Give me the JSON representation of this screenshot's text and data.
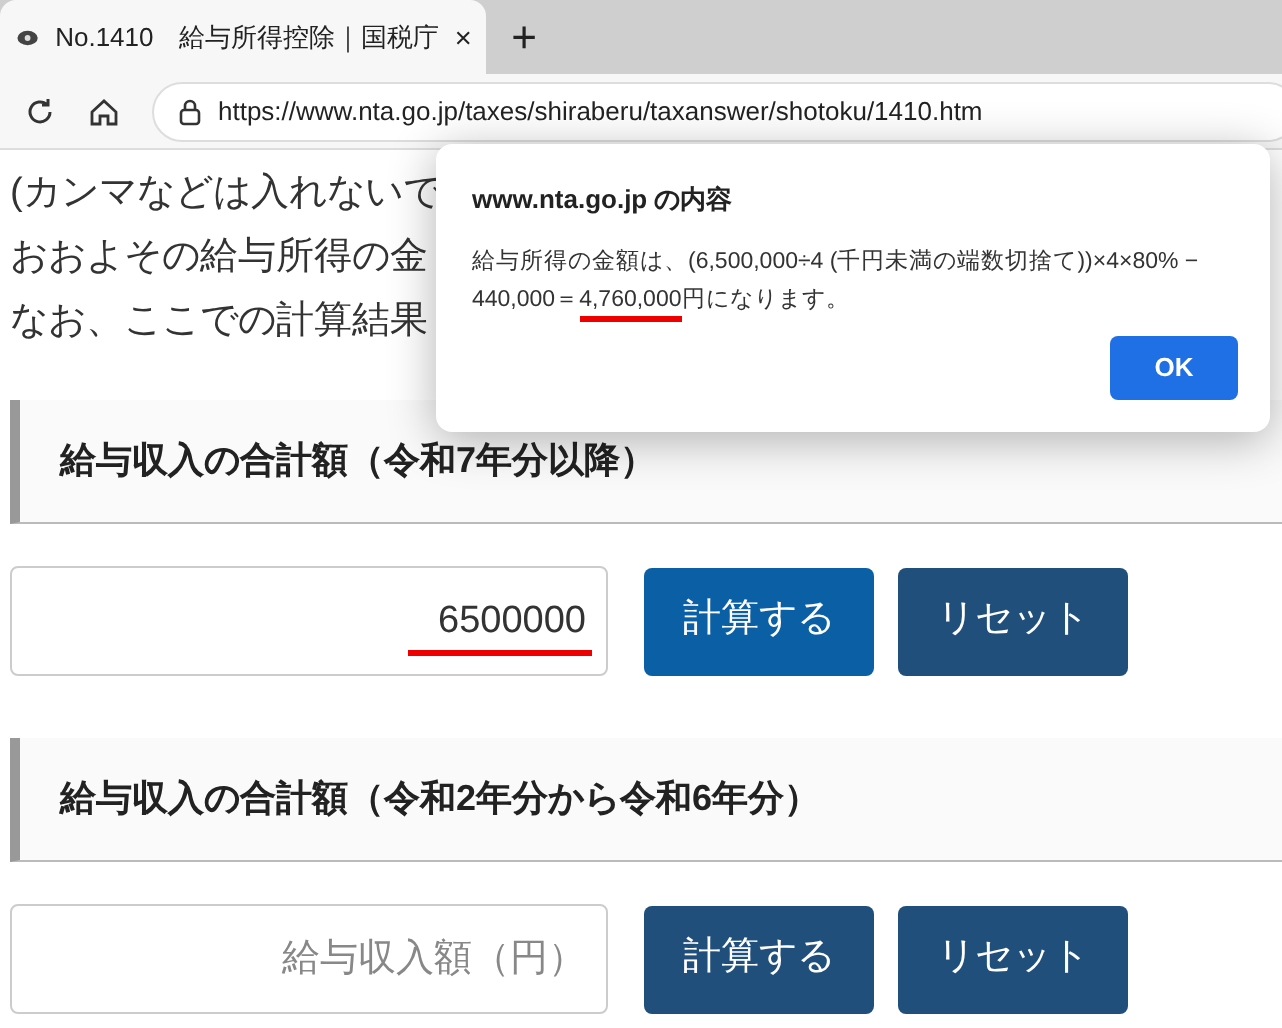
{
  "browser": {
    "tab": {
      "title": "No.1410　給与所得控除｜国税庁",
      "selected": true
    },
    "new_tab": "+",
    "url": "https://www.nta.go.jp/taxes/shiraberu/taxanswer/shotoku/1410.htm"
  },
  "page": {
    "intro_lines": [
      "(カンマなどは入れないで",
      "おおよその給与所得の金",
      "なお、ここでの計算結果"
    ],
    "sections": [
      {
        "heading": "給与収入の合計額（令和7年分以降）",
        "field": {
          "value": "6500000",
          "underlined": true
        },
        "buttons": [
          {
            "label": "計算する",
            "kind": "primary"
          },
          {
            "label": "リセット",
            "kind": "secondary"
          }
        ]
      },
      {
        "heading": "給与収入の合計額（令和2年分から令和6年分）",
        "field": {
          "placeholder": "給与収入額（円）",
          "underlined": false
        },
        "buttons": [
          {
            "label": "計算する",
            "kind": "secondary"
          },
          {
            "label": "リセット",
            "kind": "secondary"
          }
        ]
      }
    ]
  },
  "dialog": {
    "title": "www.nta.go.jp の内容",
    "message_parts": [
      {
        "text": "給与所得の金額は、(6,500,000÷4 (千円未満の端数切捨て))×4×80% − 440,000＝",
        "underlined": false
      },
      {
        "text": "4,760,000",
        "underlined": true
      },
      {
        "text": "円になります。",
        "underlined": false
      }
    ],
    "ok": "OK"
  }
}
